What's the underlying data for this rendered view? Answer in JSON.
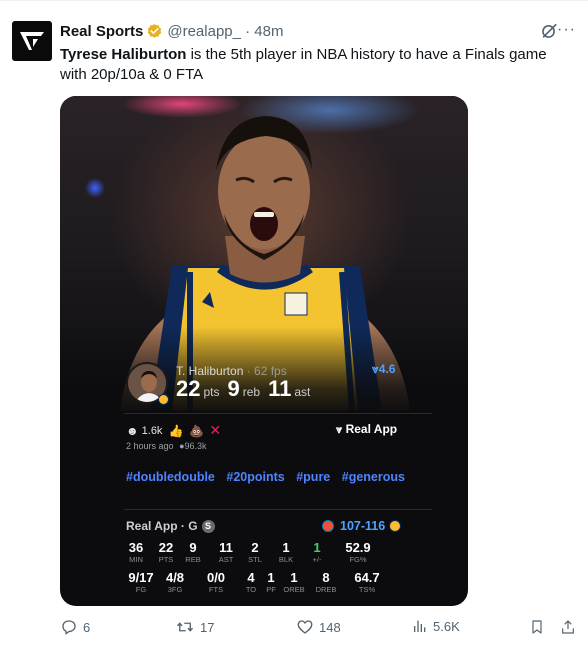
{
  "tweet": {
    "author_name": "Real Sports",
    "handle_time": "@realapp_ · 48m",
    "text_bold": "Tyrese Haliburton",
    "text_rest": " is the 5th player in NBA history to have a Finals game with 20p/10a & 0 FTA"
  },
  "card": {
    "player_name": "T. Haliburton",
    "fps": " · 62 fps",
    "pts": "22",
    "pts_label": "pts",
    "reb": "9",
    "reb_label": "reb",
    "ast": "11",
    "ast_label": "ast",
    "rating": "⩔4.6",
    "reaction_count": "1.6k",
    "real_app_label": "Real App",
    "posted": "2 hours ago",
    "views": "96.3k",
    "hashtags": [
      "#doubledouble",
      "#20points",
      "#pure",
      "#generous"
    ],
    "box_title": "Real App · G",
    "box_badge": "S",
    "score": "107-116",
    "stats_row1": [
      {
        "value": "36",
        "label": "MIN"
      },
      {
        "value": "22",
        "label": "PTS"
      },
      {
        "value": "9",
        "label": "REB"
      },
      {
        "value": "11",
        "label": "AST"
      },
      {
        "value": "2",
        "label": "STL"
      },
      {
        "value": "1",
        "label": "BLK"
      },
      {
        "value": "1",
        "label": "+/-"
      },
      {
        "value": "52.9",
        "label": "FG%"
      }
    ],
    "stats_row2": [
      {
        "value": "9/17",
        "label": "FG"
      },
      {
        "value": "4/8",
        "label": "3FG"
      },
      {
        "value": "0/0",
        "label": "FTS"
      },
      {
        "value": "4",
        "label": "TO"
      },
      {
        "value": "1",
        "label": "PF"
      },
      {
        "value": "1",
        "label": "OREB"
      },
      {
        "value": "8",
        "label": "DREB"
      },
      {
        "value": "64.7",
        "label": "TS%"
      }
    ]
  },
  "actions": {
    "replies": "6",
    "reposts": "17",
    "likes": "148",
    "views": "5.6K"
  },
  "colors": {
    "accent_blue": "#4f83ff",
    "plus_minus_green": "#3ecf6f",
    "verified_gold": "#e8b021"
  }
}
